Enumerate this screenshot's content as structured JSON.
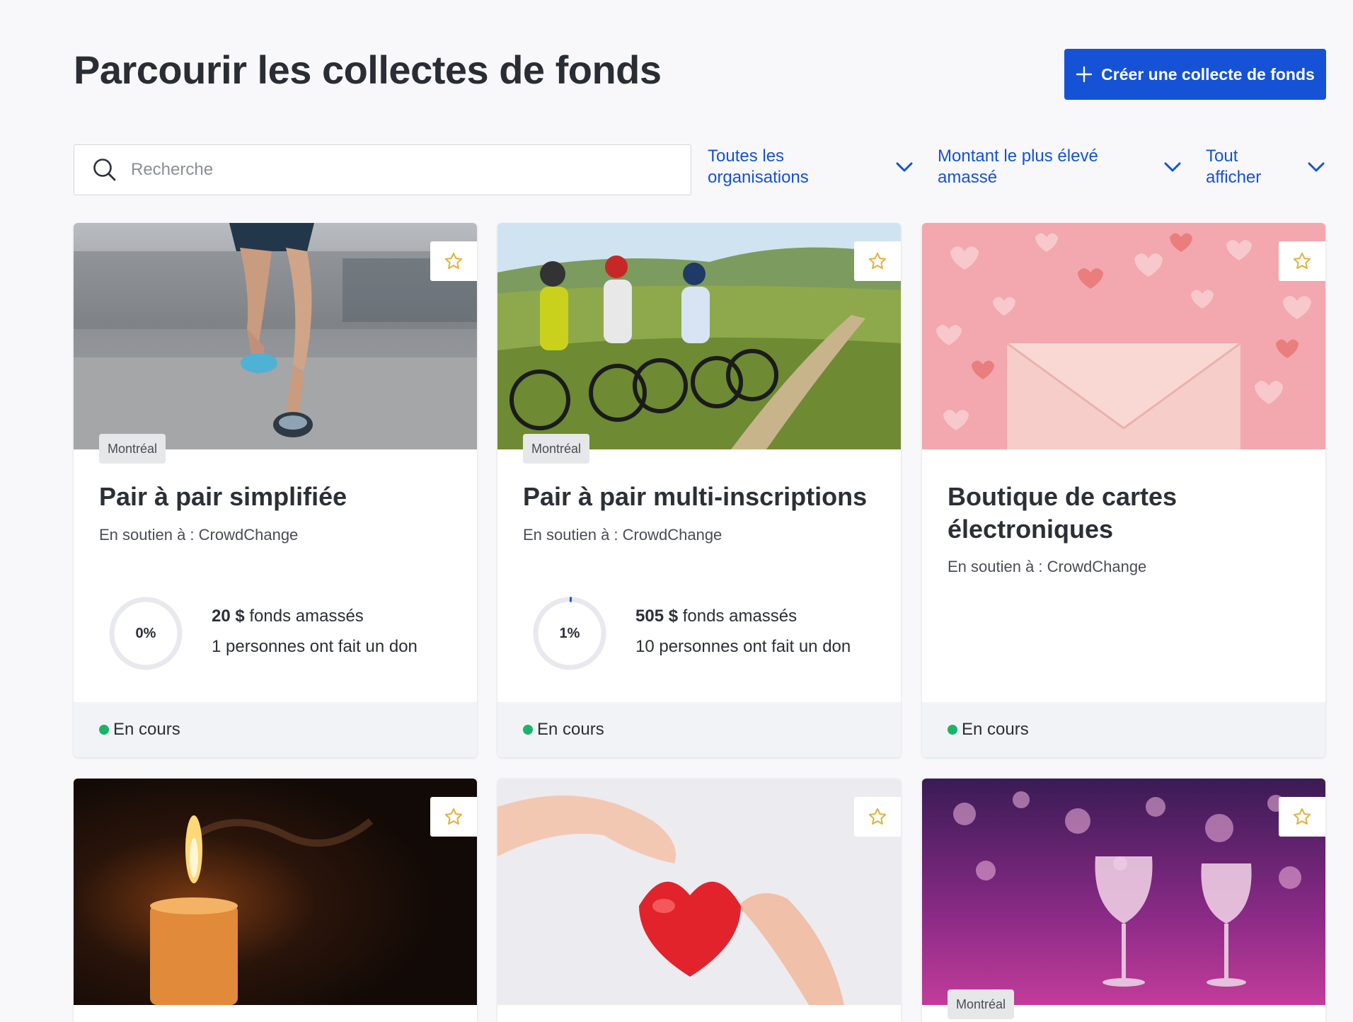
{
  "header": {
    "title": "Parcourir les collectes de fonds",
    "create_label": "Créer une collecte de fonds"
  },
  "search": {
    "placeholder": "Recherche"
  },
  "filters": [
    {
      "label": "Toutes les organisations"
    },
    {
      "label": "Montant le plus élevé amassé"
    },
    {
      "label": "Tout afficher"
    }
  ],
  "cards": [
    {
      "image": "runner-legs",
      "tag": "Montréal",
      "title": "Pair à pair simplifiée",
      "support": "En soutien à : CrowdChange",
      "percent_label": "0%",
      "percent": 0,
      "amount": "20 $",
      "raised_suffix": "fonds amassés",
      "donors": "1 personnes ont fait un don",
      "status": "En cours"
    },
    {
      "image": "mountain-bikers",
      "tag": "Montréal",
      "title": "Pair à pair multi-inscriptions",
      "support": "En soutien à : CrowdChange",
      "percent_label": "1%",
      "percent": 1,
      "amount": "505 $",
      "raised_suffix": "fonds amassés",
      "donors": "10 personnes ont fait un don",
      "status": "En cours"
    },
    {
      "image": "envelope-hearts",
      "title": "Boutique de cartes électroniques",
      "support": "En soutien à : CrowdChange",
      "status": "En cours"
    },
    {
      "image": "candle"
    },
    {
      "image": "hands-heart"
    },
    {
      "image": "wine-glasses",
      "tag": "Montréal"
    }
  ],
  "colors": {
    "accent": "#1552d6",
    "status_green": "#1bb36b",
    "star": "#e2b43c",
    "ring_track": "#e8e9ee"
  }
}
